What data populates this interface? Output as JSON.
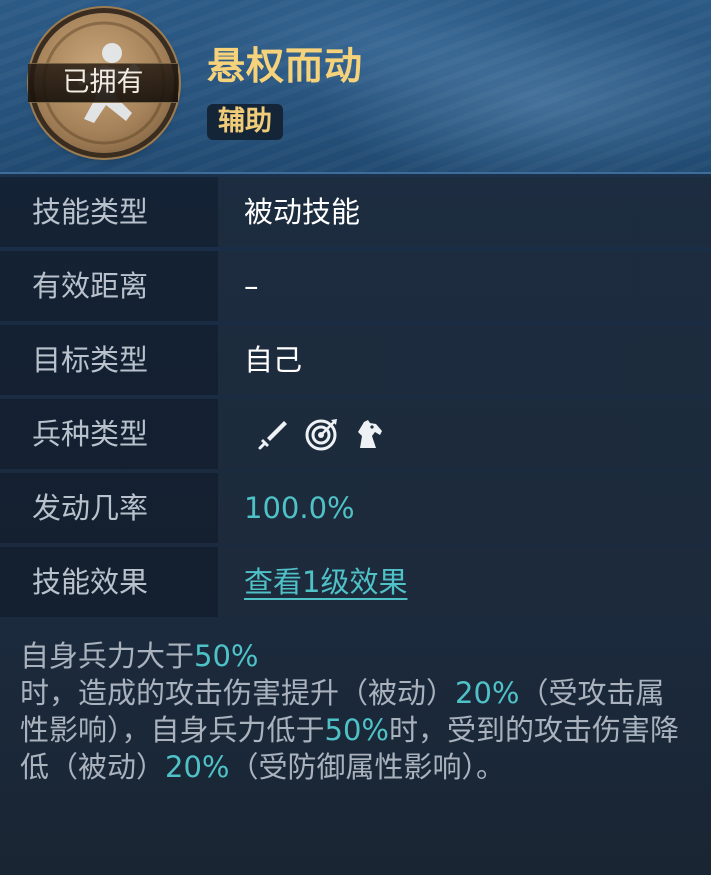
{
  "header": {
    "owned_badge": "已拥有",
    "title": "悬权而动",
    "tag": "辅助",
    "emblem_icon": "running-figure-icon"
  },
  "rows": [
    {
      "label": "技能类型",
      "value": "被动技能"
    },
    {
      "label": "有效距离",
      "value": "–"
    },
    {
      "label": "目标类型",
      "value": "自己"
    },
    {
      "label": "兵种类型",
      "icons": [
        "sword-icon",
        "target-icon",
        "horse-icon"
      ]
    },
    {
      "label": "发动几率",
      "value": "100.0%"
    },
    {
      "label": "技能效果",
      "value": "查看1级效果"
    }
  ],
  "description": {
    "p1": "自身兵力大于",
    "v1": "50%",
    "p2": "时，造成的攻击伤害提升（被动）",
    "v2": "20%",
    "p3": "（受攻击属性影响），自身兵力低于",
    "v3": "50%",
    "p4": "时，受到的攻击伤害降低（被动）",
    "v4": "20%",
    "p5": "（受防御属性影响）。"
  },
  "colors": {
    "title": "#f6d27a",
    "highlight": "#4fc2c8",
    "label": "#b9c2cc"
  }
}
